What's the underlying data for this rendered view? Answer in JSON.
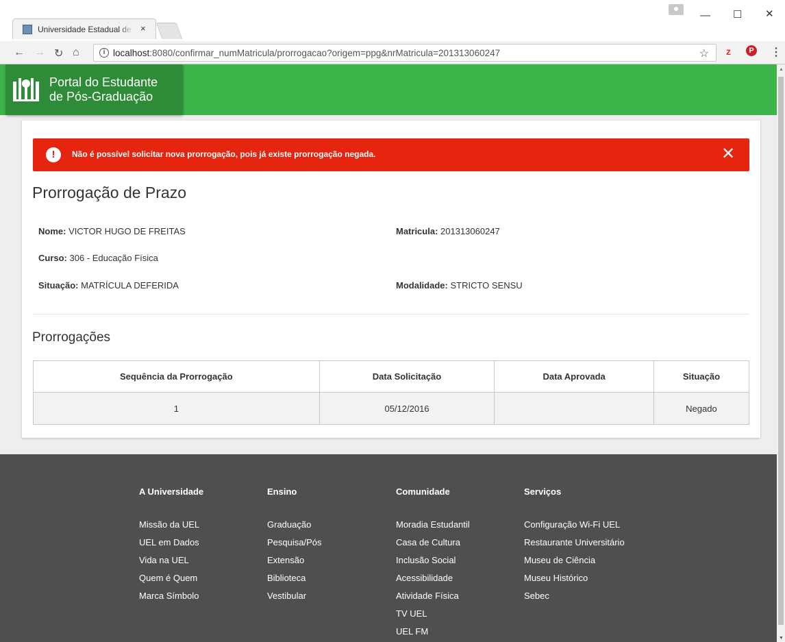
{
  "browser": {
    "tab_title": "Universidade Estadual de Londrina",
    "tab_close": "×",
    "url_host": "localhost",
    "url_rest": ":8080/confirmar_numMatricula/prorrogacao?origem=ppg&nrMatricula=201313060247"
  },
  "header": {
    "brand_line1": "Portal do Estudante",
    "brand_line2": "de Pós-Graduação"
  },
  "alert": {
    "icon": "!",
    "message": "Não é possível solicitar nova prorrogação, pois já existe prorrogação negada.",
    "close": "✕"
  },
  "main": {
    "title": "Prorrogação de Prazo",
    "fields": {
      "nome_label": "Nome:",
      "nome_value": "VICTOR HUGO DE FREITAS",
      "matricula_label": "Matricula:",
      "matricula_value": "201313060247",
      "curso_label": "Curso:",
      "curso_value": "306 - Educação Física",
      "situacao_label": "Situação:",
      "situacao_value": "MATRÍCULA DEFERIDA",
      "modalidade_label": "Modalidade:",
      "modalidade_value": "STRICTO SENSU"
    },
    "section_title": "Prorrogações",
    "table": {
      "headers": [
        "Sequência da Prorrogação",
        "Data Solicitação",
        "Data Aprovada",
        "Situação"
      ],
      "rows": [
        [
          "1",
          "05/12/2016",
          "",
          "Negado"
        ]
      ]
    }
  },
  "footer": {
    "columns": [
      {
        "heading": "A Universidade",
        "links": [
          "Missão da UEL",
          "UEL em Dados",
          "Vida na UEL",
          "Quem é Quem",
          "Marca Símbolo"
        ]
      },
      {
        "heading": "Ensino",
        "links": [
          "Graduação",
          "Pesquisa/Pós",
          "Extensão",
          "Biblioteca",
          "Vestibular"
        ]
      },
      {
        "heading": "Comunidade",
        "links": [
          "Moradia Estudantil",
          "Casa de Cultura",
          "Inclusão Social",
          "Acessibilidade",
          "Atividade Física",
          "TV UEL",
          "UEL FM"
        ]
      },
      {
        "heading": "Serviços",
        "links": [
          "Configuração Wi-Fi UEL",
          "Restaurante Universitário",
          "Museu de Ciência",
          "Museu Histórico",
          "Sebec"
        ]
      }
    ]
  },
  "colors": {
    "header_green": "#3db54a",
    "brand_green": "#2e8b37",
    "alert_red": "#e5250f",
    "footer_gray": "#4f4f4f"
  }
}
